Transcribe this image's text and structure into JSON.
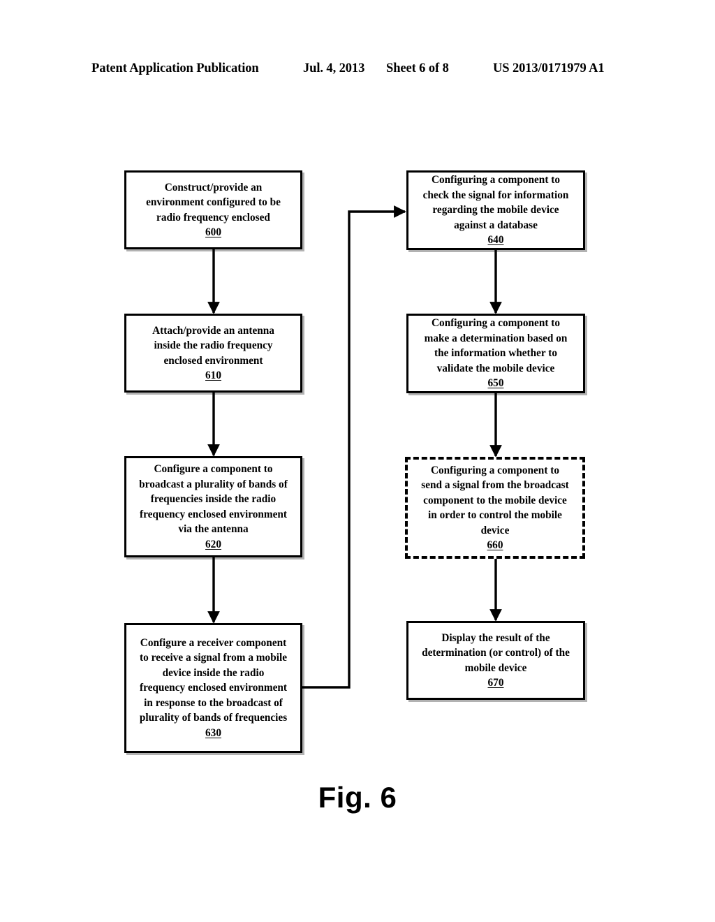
{
  "header": {
    "publication": "Patent Application Publication",
    "date": "Jul. 4, 2013",
    "sheet": "Sheet 6 of 8",
    "patent_number": "US 2013/0171979 A1"
  },
  "figure": {
    "caption": "Fig. 6"
  },
  "flowchart": {
    "nodes": [
      {
        "id": "600",
        "text": "Construct/provide an\nenvironment configured to be\nradio frequency enclosed",
        "ref": "600",
        "style": "solid",
        "column": "left"
      },
      {
        "id": "610",
        "text": "Attach/provide an antenna\ninside the radio frequency\nenclosed environment",
        "ref": "610",
        "style": "solid",
        "column": "left"
      },
      {
        "id": "620",
        "text": "Configure a component to\nbroadcast a plurality of bands of\nfrequencies inside the radio\nfrequency enclosed environment\nvia the antenna",
        "ref": "620",
        "style": "solid",
        "column": "left"
      },
      {
        "id": "630",
        "text": "Configure a receiver component\nto receive a signal from a mobile\ndevice inside the radio\nfrequency enclosed environment\nin response to the broadcast of\nplurality of bands of frequencies",
        "ref": "630",
        "style": "solid",
        "column": "left"
      },
      {
        "id": "640",
        "text": "Configuring a component to\ncheck the signal for information\nregarding the mobile device\nagainst a database",
        "ref": "640",
        "style": "solid",
        "column": "right"
      },
      {
        "id": "650",
        "text": "Configuring a component to\nmake a determination based on\nthe information whether to\nvalidate the mobile device",
        "ref": "650",
        "style": "solid",
        "column": "right"
      },
      {
        "id": "660",
        "text": "Configuring a component to\nsend a signal from the broadcast\ncomponent to the mobile device\nin order to control the mobile\ndevice",
        "ref": "660",
        "style": "dashed",
        "column": "right"
      },
      {
        "id": "670",
        "text": "Display the result of the\ndetermination (or control) of the\nmobile device",
        "ref": "670",
        "style": "solid",
        "column": "right"
      }
    ],
    "edges": [
      {
        "from": "600",
        "to": "610",
        "kind": "straight-down"
      },
      {
        "from": "610",
        "to": "620",
        "kind": "straight-down"
      },
      {
        "from": "620",
        "to": "630",
        "kind": "straight-down"
      },
      {
        "from": "630",
        "to": "640",
        "kind": "right-up-right"
      },
      {
        "from": "640",
        "to": "650",
        "kind": "straight-down"
      },
      {
        "from": "650",
        "to": "660",
        "kind": "straight-down"
      },
      {
        "from": "660",
        "to": "670",
        "kind": "straight-down"
      }
    ]
  },
  "colors": {
    "ink": "#000000",
    "page": "#ffffff"
  }
}
